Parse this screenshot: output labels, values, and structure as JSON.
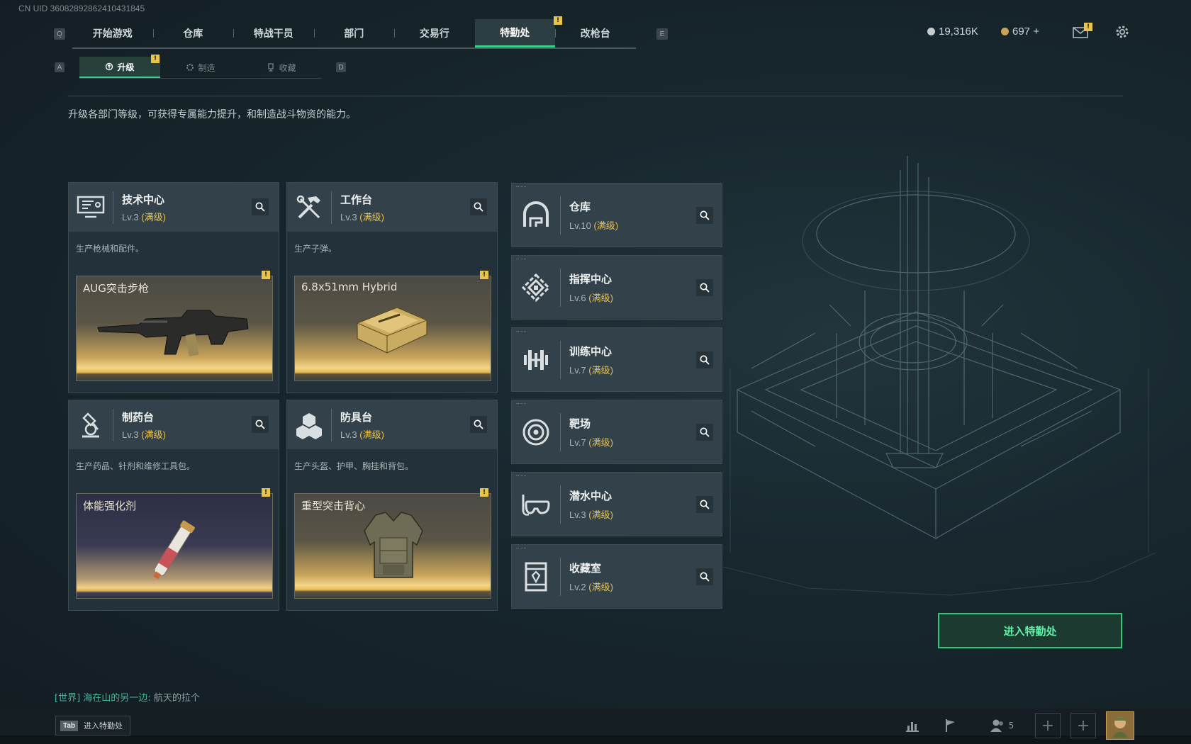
{
  "uid": "CN UID 36082892862410431845",
  "keys": {
    "left": "Q",
    "right": "E",
    "sub_left": "A",
    "sub_right": "D"
  },
  "top_tabs": [
    {
      "label": "开始游戏"
    },
    {
      "label": "仓库"
    },
    {
      "label": "特战干员"
    },
    {
      "label": "部门"
    },
    {
      "label": "交易行"
    },
    {
      "label": "特勤处",
      "active": true
    },
    {
      "label": "改枪台"
    }
  ],
  "badge_text": "!",
  "currency": {
    "silver": "19,316K",
    "gold": "697 +"
  },
  "sub_tabs": [
    {
      "label": "升级",
      "active": true,
      "icon": "upgrade-icon"
    },
    {
      "label": "制造",
      "icon": "gear-icon"
    },
    {
      "label": "收藏",
      "icon": "trophy-icon"
    }
  ],
  "description": "升级各部门等级，可获得专属能力提升，和制造战斗物资的能力。",
  "max_label": "(满级)",
  "dept_cards": [
    {
      "name": "技术中心",
      "level": "Lv.3",
      "desc": "生产枪械和配件。",
      "item": "AUG突击步枪",
      "item_style": "gold",
      "icon": "monitor-icon"
    },
    {
      "name": "工作台",
      "level": "Lv.3",
      "desc": "生产子弹。",
      "item": "6.8x51mm Hybrid",
      "item_style": "gold",
      "icon": "hammer-icon"
    },
    {
      "name": "制药台",
      "level": "Lv.3",
      "desc": "生产药品、针剂和维修工具包。",
      "item": "体能强化剂",
      "item_style": "purple",
      "icon": "microscope-icon"
    },
    {
      "name": "防具台",
      "level": "Lv.3",
      "desc": "生产头盔、护甲、胸挂和背包。",
      "item": "重型突击背心",
      "item_style": "gold",
      "icon": "cubes-icon"
    }
  ],
  "facility_list": [
    {
      "name": "仓库",
      "level": "Lv.10",
      "icon": "warehouse-icon"
    },
    {
      "name": "指挥中心",
      "level": "Lv.6",
      "icon": "command-icon"
    },
    {
      "name": "训练中心",
      "level": "Lv.7",
      "icon": "dumbbell-icon"
    },
    {
      "name": "靶场",
      "level": "Lv.7",
      "icon": "target-icon"
    },
    {
      "name": "潜水中心",
      "level": "Lv.3",
      "icon": "diving-mask-icon"
    },
    {
      "name": "收藏室",
      "level": "Lv.2",
      "icon": "showcase-icon"
    }
  ],
  "enter_button": "进入特勤处",
  "chat": {
    "channel": "[世界]",
    "user": "海在山的另一边:",
    "message": "航天的拉个"
  },
  "tab_hint": {
    "key": "Tab",
    "label": "进入特勤处"
  },
  "friends_count": "5",
  "colors": {
    "accent_green": "#3ccf8b",
    "max_gold": "#e7c04d",
    "badge_yellow": "#e8c54a"
  }
}
